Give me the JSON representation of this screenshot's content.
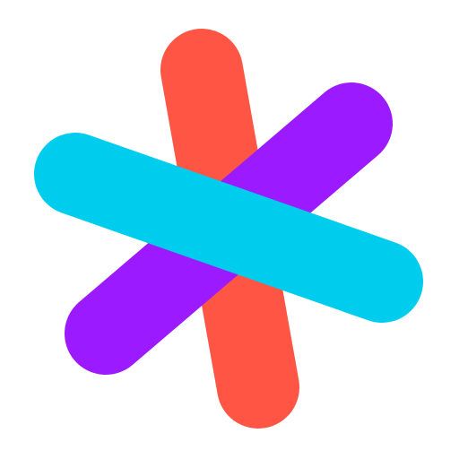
{
  "logo": {
    "icon": "asterisk-logo-icon",
    "colors": {
      "background": "#ffffff",
      "coral_stroke": "#FF5544",
      "purple_stroke": "#9B1AFF",
      "cyan_stroke": "#00CCEE"
    }
  }
}
